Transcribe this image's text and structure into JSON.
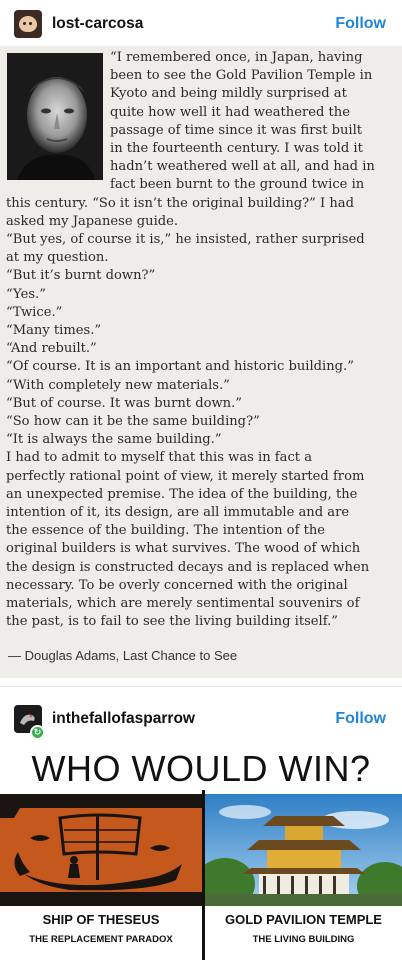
{
  "post1": {
    "username": "lost-carcosa",
    "follow_label": "Follow",
    "quote_lines": [
      "“I remembered once, in Japan, having",
      "been to see the Gold Pavilion Temple in",
      "Kyoto and being mildly surprised at",
      "quite how well it had weathered the",
      "passage of time since it was first built",
      "in the fourteenth century. I was told it",
      "hadn’t weathered well at all, and had in",
      "fact been burnt to the ground twice in",
      "this century. “So it isn’t the original building?” I had",
      "asked my Japanese guide.",
      "“But yes, of course it is,” he insisted, rather surprised",
      "at my question.",
      "“But it’s burnt down?”",
      "“Yes.”",
      "“Twice.”",
      "“Many times.”",
      "“And rebuilt.”",
      "“Of course. It is an important and historic building.”",
      "“With completely new materials.”",
      "“But of course. It was burnt down.”",
      "“So how can it be the same building?”",
      "“It is always the same building.”",
      "I had to admit to myself that this was in fact a",
      "perfectly rational point of view, it merely started from",
      "an unexpected premise. The idea of the building, the",
      "intention of it, its design, are all immutable and are",
      "the essence of the building. The intention of the",
      "original builders is what survives. The wood of which",
      "the design is constructed decays and is replaced when",
      "necessary. To be overly concerned with the original",
      "materials, which are merely sentimental souvenirs of",
      "the past, is to fail to see the living building itself.”"
    ],
    "attribution": "— Douglas Adams, Last Chance to See"
  },
  "post2": {
    "username": "inthefallofasparrow",
    "follow_label": "Follow",
    "meme_title": "WHO WOULD WIN?",
    "left": {
      "title": "SHIP OF THESEUS",
      "subtitle": "THE REPLACEMENT PARADOX"
    },
    "right": {
      "title": "GOLD PAVILION TEMPLE",
      "subtitle": "THE LIVING BUILDING"
    }
  },
  "colors": {
    "accent": "#1f86d9",
    "card_bg": "#efede8",
    "reblog": "#35b24a"
  },
  "icons": {
    "reblog": "reblog-icon"
  }
}
